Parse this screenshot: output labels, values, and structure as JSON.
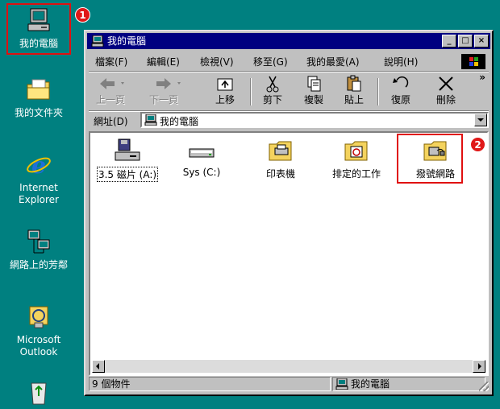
{
  "desktop": {
    "icons": [
      {
        "label": "我的電腦"
      },
      {
        "label": "我的文件夾"
      },
      {
        "label": "Internet\nExplorer"
      },
      {
        "label": "網路上的芳鄰"
      },
      {
        "label": "Microsoft\nOutlook"
      }
    ],
    "badge1": "1",
    "badge2": "2"
  },
  "window": {
    "title": "我的電腦",
    "controls": {
      "minimize": "_",
      "maximize": "□",
      "close": "×"
    },
    "menu": [
      "檔案(F)",
      "編輯(E)",
      "檢視(V)",
      "移至(G)",
      "我的最愛(A)",
      "說明(H)"
    ],
    "toolbar": {
      "back": "上一頁",
      "forward": "下一頁",
      "up": "上移",
      "cut": "剪下",
      "copy": "複製",
      "paste": "貼上",
      "undo": "復原",
      "delete": "刪除",
      "more": "»"
    },
    "address": {
      "label": "網址(D)",
      "value": "我的電腦"
    },
    "items": [
      {
        "label": "3.5 磁片 (A:)"
      },
      {
        "label": "Sys (C:)"
      },
      {
        "label": "印表機"
      },
      {
        "label": "排定的工作"
      },
      {
        "label": "撥號網路"
      }
    ],
    "status": {
      "count": "9 個物件",
      "location": "我的電腦"
    }
  },
  "colors": {
    "desktop": "#008080",
    "titlebar": "#000080",
    "highlight": "#e01010"
  }
}
